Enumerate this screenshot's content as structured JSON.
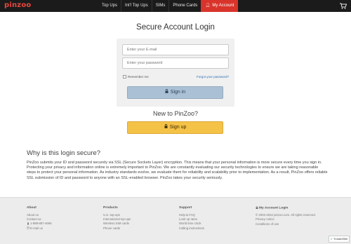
{
  "brand": {
    "logo_text": "pinzoo",
    "accent": "#d9342b"
  },
  "nav": {
    "items": [
      "Top Ups",
      "Int'l Top Ups",
      "SIMs",
      "Phone Cards"
    ],
    "active_label": "My Account"
  },
  "login": {
    "title": "Secure Account Login",
    "email_placeholder": "Enter your E-mail",
    "password_placeholder": "Enter your password",
    "remember_label": "Remember me",
    "forgot_label": "Forgot your password?",
    "signin_label": "Sign in"
  },
  "signup": {
    "title": "New to PinZoo?",
    "button_label": "Sign up"
  },
  "why": {
    "title": "Why is this login secure?",
    "body": "PinZoo submits your ID and password securely via SSL (Secure Sockets Layer) encryption. This means that your personal information is more secure every time you sign in. Protecting your privacy and information online is extremely important to PinZoo. We are constantly evaluating our security technologies to ensure we are taking reasonable steps to protect your personal information. As industry standards evolve, we evaluate them for reliability and scalability prior to implementation. As a result, PinZoo offers reliable SSL submission of ID and password to anyone with an SSL-enabled browser. PinZoo takes your security seriously."
  },
  "footer": {
    "about": {
      "title": "About",
      "links": [
        "About us",
        "Contact us",
        "1-888-887-4666",
        "E-mail us"
      ]
    },
    "products": {
      "title": "Products",
      "links": [
        "U.S. top-ups",
        "International top-ups",
        "Wireless SIM cards",
        "Phone cards"
      ]
    },
    "support": {
      "title": "Support",
      "links": [
        "Help & FAQ",
        "Look up rates",
        "World time clock",
        "Calling instructions"
      ]
    },
    "account": {
      "title": "My Account Login",
      "links": [
        "© 2002-2022 pinzoo.com. All rights reserved.",
        "Privacy notice",
        "Conditions of use"
      ]
    },
    "trusted_badge": "TrustedSite"
  }
}
